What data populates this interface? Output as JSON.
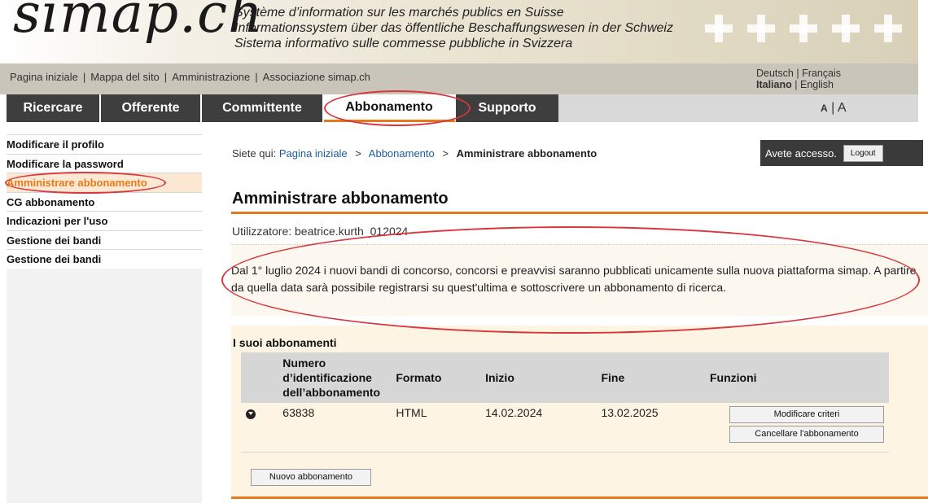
{
  "header": {
    "logo": "simap.ch",
    "tagline_lines": [
      "Système d’information sur les marchés publics en Suisse",
      "Informationssystem über das öffentliche Beschaffungswesen in der Schweiz",
      "Sistema informativo sulle commesse pubbliche in Svizzera"
    ]
  },
  "toplinks": {
    "items": [
      "Pagina iniziale",
      "Mappa del sito",
      "Amministrazione",
      "Associazione simap.ch"
    ],
    "separator": "|"
  },
  "languages": {
    "deutsch": "Deutsch",
    "francais": "Français",
    "italiano": "Italiano",
    "english": "English",
    "separator": "|"
  },
  "nav": {
    "tabs": [
      {
        "label": "Ricercare"
      },
      {
        "label": "Offerente"
      },
      {
        "label": "Committente"
      },
      {
        "label": "Abbonamento",
        "active": true
      },
      {
        "label": "Supporto"
      }
    ],
    "text_size_small": "A",
    "text_size_sep": "|",
    "text_size_large": "A"
  },
  "sidebar": {
    "items": [
      {
        "label": "Modificare il profilo"
      },
      {
        "label": "Modificare la password"
      },
      {
        "label": "Amministrare abbonamento",
        "active": true
      },
      {
        "label": "CG abbonamento"
      },
      {
        "label": "Indicazioni per l'uso"
      },
      {
        "label": "Gestione dei bandi"
      },
      {
        "label": "Gestione dei bandi"
      }
    ]
  },
  "breadcrumb": {
    "prefix": "Siete qui:",
    "home": "Pagina iniziale",
    "sep": ">",
    "section": "Abbonamento",
    "current": "Amministrare abbonamento"
  },
  "session": {
    "status": "Avete accesso.",
    "logout_label": "Logout"
  },
  "main": {
    "title": "Amministrare abbonamento",
    "user_line": "Utilizzatore: beatrice.kurth_012024",
    "notice": "Dal 1° luglio 2024 i nuovi bandi di concorso, concorsi e preavvisi saranno pubblicati unicamente sulla nuova piattaforma simap. A partire da quella data sarà possibile registrarsi su quest'ultima e sottoscrivere un abbonamento di ricerca."
  },
  "subscriptions": {
    "title": "I suoi abbonamenti",
    "columns": {
      "id_line1": "Numero",
      "id_line2": "d’identificazione",
      "id_line3": "dell’abbonamento",
      "format": "Formato",
      "start": "Inizio",
      "end": "Fine",
      "functions": "Funzioni"
    },
    "rows": [
      {
        "id": "63838",
        "format": "HTML",
        "start": "14.02.2024",
        "end": "13.02.2025",
        "modify_label": "Modificare criteri",
        "cancel_label": "Cancellare l'abbonamento"
      }
    ],
    "new_label": "Nuovo abbonamento"
  },
  "colors": {
    "accent": "#e47a1b",
    "nav_bg": "#3e3e3e",
    "annotation": "#d9363e"
  }
}
